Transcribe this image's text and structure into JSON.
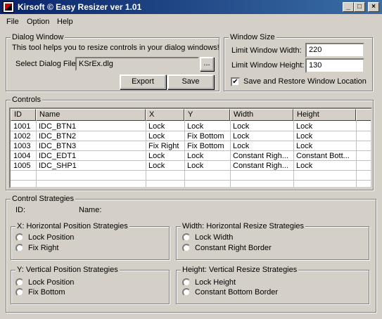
{
  "window": {
    "title": "Kirsoft © Easy Resizer ver 1.01",
    "minimize_glyph": "_",
    "maximize_glyph": "□",
    "close_glyph": "×"
  },
  "menu": {
    "file": "File",
    "option": "Option",
    "help": "Help"
  },
  "dialog_window": {
    "group_label": "Dialog Window",
    "description": "This tool helps you to resize controls in your dialog windows!",
    "select_label": "Select Dialog File:",
    "file_value": "KSrEx.dlg",
    "browse_label": "...",
    "export_label": "Export",
    "save_label": "Save"
  },
  "window_size": {
    "group_label": "Window Size",
    "width_label": "Limit Window Width:",
    "width_value": "220",
    "height_label": "Limit Window Height:",
    "height_value": "130",
    "save_restore_label": "Save and Restore Window Location",
    "save_restore_checked": true,
    "check_glyph": "✔"
  },
  "controls": {
    "group_label": "Controls",
    "columns": [
      "ID",
      "Name",
      "X",
      "Y",
      "Width",
      "Height"
    ],
    "rows": [
      [
        "1001",
        "IDC_BTN1",
        "Lock",
        "Lock",
        "Lock",
        "Lock"
      ],
      [
        "1002",
        "IDC_BTN2",
        "Lock",
        "Fix Bottom",
        "Lock",
        "Lock"
      ],
      [
        "1003",
        "IDC_BTN3",
        "Fix Right",
        "Fix Bottom",
        "Lock",
        "Lock"
      ],
      [
        "1004",
        "IDC_EDT1",
        "Lock",
        "Lock",
        "Constant Righ...",
        "Constant Bott..."
      ],
      [
        "1005",
        "IDC_SHP1",
        "Lock",
        "Lock",
        "Constant Righ...",
        "Lock"
      ]
    ]
  },
  "strategies": {
    "group_label": "Control Strategies",
    "id_label": "ID:",
    "name_label": "Name:",
    "x": {
      "group_label": "X: Horizontal Position Strategies",
      "options": [
        "Lock Position",
        "Fix Right"
      ]
    },
    "width": {
      "group_label": "Width: Horizontal Resize Strategies",
      "options": [
        "Lock Width",
        "Constant Right Border"
      ]
    },
    "y": {
      "group_label": "Y: Vertical Position Strategies",
      "options": [
        "Lock Position",
        "Fix Bottom"
      ]
    },
    "height": {
      "group_label": "Height: Vertical Resize Strategies",
      "options": [
        "Lock Height",
        "Constant Bottom Border"
      ]
    }
  }
}
